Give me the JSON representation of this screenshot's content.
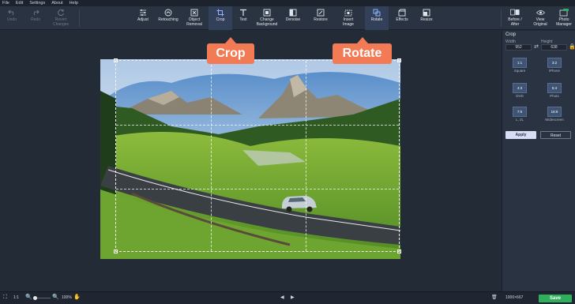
{
  "menu": [
    "File",
    "Edit",
    "Settings",
    "About",
    "Help"
  ],
  "history": [
    {
      "label": "Undo"
    },
    {
      "label": "Redo"
    },
    {
      "label": "Revert\nChanges"
    }
  ],
  "tools": [
    {
      "label": "Adjust"
    },
    {
      "label": "Retouching"
    },
    {
      "label": "Object\nRemoval"
    },
    {
      "label": "Crop"
    },
    {
      "label": "Text"
    },
    {
      "label": "Change\nBackground"
    },
    {
      "label": "Denoise"
    },
    {
      "label": "Restore"
    },
    {
      "label": "Insert\nImage"
    },
    {
      "label": "Rotate"
    },
    {
      "label": "Effects"
    },
    {
      "label": "Resize"
    }
  ],
  "right_tools": [
    {
      "label": "Before /\nAfter"
    },
    {
      "label": "View\nOriginal"
    },
    {
      "label": "Photo\nManager"
    }
  ],
  "callouts": {
    "crop": "Crop",
    "rotate": "Rotate"
  },
  "panel": {
    "title": "Crop",
    "width_label": "Width",
    "height_label": "Height",
    "width_value": "952",
    "height_value": "638",
    "presets": [
      {
        "ratio": "1:1",
        "caption": "Square"
      },
      {
        "ratio": "3:2",
        "caption": "iPhone"
      },
      {
        "ratio": "4:3",
        "caption": "DVD"
      },
      {
        "ratio": "5:4",
        "caption": "Photo"
      },
      {
        "ratio": "7:5",
        "caption": "L, 2L"
      },
      {
        "ratio": "16:9",
        "caption": "Widescreen"
      }
    ],
    "apply": "Apply",
    "reset": "Reset"
  },
  "status": {
    "zoom_fit": "1:1",
    "zoom": "100%",
    "dimensions": "1000×667",
    "save": "Save"
  },
  "colors": {
    "accent": "#f27b55",
    "save": "#2fae5b",
    "apply": "#d9def7"
  }
}
